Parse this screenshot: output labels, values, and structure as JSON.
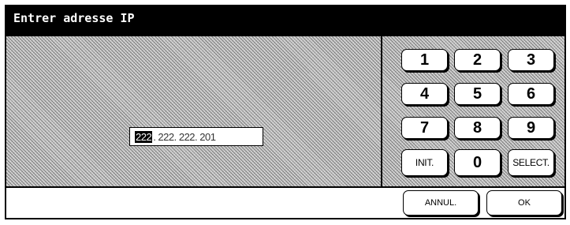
{
  "window": {
    "title": "Entrer adresse IP"
  },
  "ip_field": {
    "active_octet": "222",
    "rest": ". 222. 222. 201"
  },
  "keypad": {
    "keys": [
      "1",
      "2",
      "3",
      "4",
      "5",
      "6",
      "7",
      "8",
      "9",
      "INIT.",
      "0",
      "SELECT."
    ]
  },
  "footer": {
    "cancel_label": "ANNUL.",
    "ok_label": "OK"
  }
}
